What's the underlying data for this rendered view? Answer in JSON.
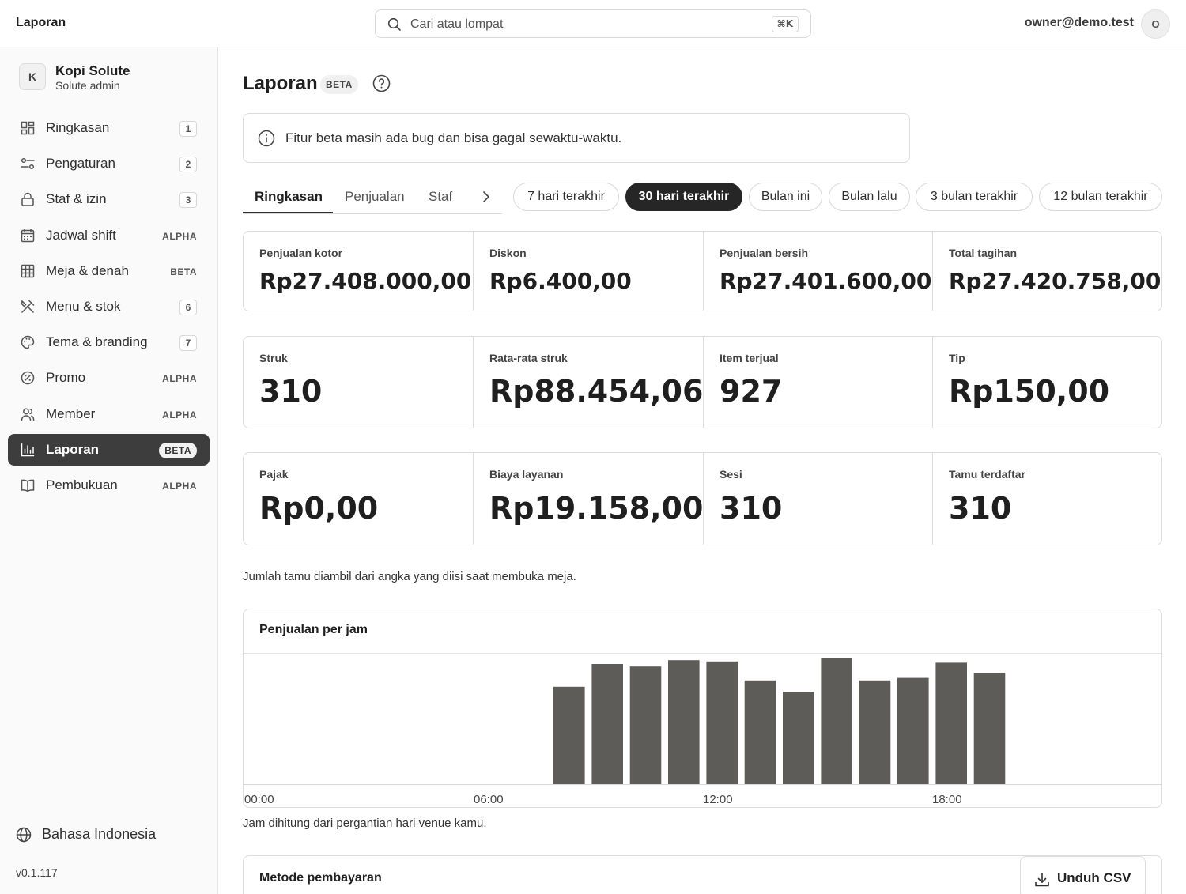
{
  "header": {
    "app_title": "Laporan",
    "search_placeholder": "Cari atau lompat",
    "search_shortcut": "⌘K",
    "user_email": "owner@demo.test",
    "user_initial": "O"
  },
  "sidebar": {
    "org_initial": "K",
    "org_name": "Kopi Solute",
    "org_role": "Solute admin",
    "items": [
      {
        "label": "Ringkasan",
        "badge": "1",
        "icon": "dashboard-icon"
      },
      {
        "label": "Pengaturan",
        "badge": "2",
        "icon": "sliders-icon"
      },
      {
        "label": "Staf & izin",
        "badge": "3",
        "icon": "lock-icon"
      },
      {
        "label": "Jadwal shift",
        "badge": "ALPHA",
        "icon": "calendar-icon"
      },
      {
        "label": "Meja & denah",
        "badge": "BETA",
        "icon": "grid-icon"
      },
      {
        "label": "Menu & stok",
        "badge": "6",
        "icon": "utensils-icon"
      },
      {
        "label": "Tema & branding",
        "badge": "7",
        "icon": "palette-icon"
      },
      {
        "label": "Promo",
        "badge": "ALPHA",
        "icon": "percent-badge-icon"
      },
      {
        "label": "Member",
        "badge": "ALPHA",
        "icon": "users-icon"
      },
      {
        "label": "Laporan",
        "badge": "BETA",
        "icon": "bar-chart-icon",
        "active": true
      },
      {
        "label": "Pembukuan",
        "badge": "ALPHA",
        "icon": "book-icon"
      }
    ],
    "language": "Bahasa Indonesia",
    "version": "v0.1.117"
  },
  "page": {
    "title": "Laporan",
    "title_badge": "BETA",
    "alert": "Fitur beta masih ada bug dan bisa gagal sewaktu-waktu.",
    "tabs": [
      "Ringkasan",
      "Penjualan",
      "Staf"
    ],
    "active_tab": "Ringkasan",
    "ranges": [
      "7 hari terakhir",
      "30 hari terakhir",
      "Bulan ini",
      "Bulan lalu",
      "3 bulan terakhir",
      "12 bulan terakhir"
    ],
    "active_range": "30 hari terakhir",
    "stats_row1": [
      {
        "label": "Penjualan kotor",
        "value": "Rp27.408.000,00"
      },
      {
        "label": "Diskon",
        "value": "Rp6.400,00"
      },
      {
        "label": "Penjualan bersih",
        "value": "Rp27.401.600,00"
      },
      {
        "label": "Total tagihan",
        "value": "Rp27.420.758,00"
      }
    ],
    "stats_row2": [
      {
        "label": "Struk",
        "value": "310"
      },
      {
        "label": "Rata-rata struk",
        "value": "Rp88.454,06"
      },
      {
        "label": "Item terjual",
        "value": "927"
      },
      {
        "label": "Tip",
        "value": "Rp150,00"
      }
    ],
    "stats_row3": [
      {
        "label": "Pajak",
        "value": "Rp0,00"
      },
      {
        "label": "Biaya layanan",
        "value": "Rp19.158,00"
      },
      {
        "label": "Sesi",
        "value": "310"
      },
      {
        "label": "Tamu terdaftar",
        "value": "310"
      }
    ],
    "guest_note": "Jumlah tamu diambil dari angka yang diisi saat membuka meja.",
    "chart_note": "Jam dihitung dari pergantian hari venue kamu.",
    "payment_title": "Metode pembayaran",
    "csv_button": "Unduh CSV"
  },
  "chart_data": {
    "type": "bar",
    "title": "Penjualan per jam",
    "x_tick_labels": [
      "00:00",
      "06:00",
      "12:00",
      "18:00"
    ],
    "x": [
      8,
      9,
      10,
      11,
      12,
      13,
      14,
      15,
      16,
      17,
      18,
      19
    ],
    "values": [
      0.77,
      0.95,
      0.93,
      0.98,
      0.97,
      0.82,
      0.73,
      1.0,
      0.82,
      0.84,
      0.96,
      0.88
    ],
    "ylim": [
      0,
      1
    ],
    "color": "#5d5c58",
    "grid": false
  }
}
